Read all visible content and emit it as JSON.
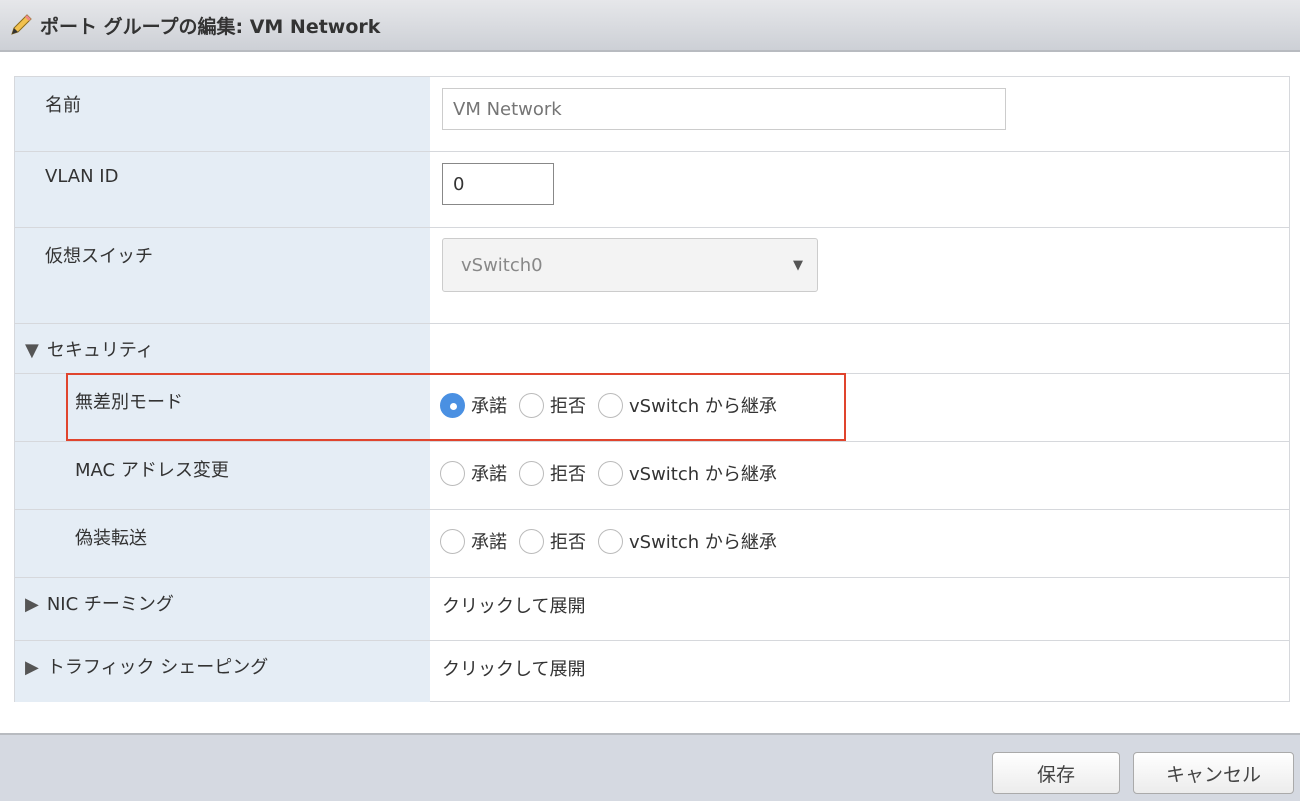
{
  "header": {
    "title": "ポート グループの編集: VM Network",
    "icon": "pencil-icon"
  },
  "fields": {
    "name": {
      "label": "名前",
      "placeholder": "VM Network"
    },
    "vlan": {
      "label": "VLAN ID",
      "value": "0"
    },
    "vswitch": {
      "label": "仮想スイッチ",
      "value": "vSwitch0"
    }
  },
  "security": {
    "label": "セキュリティ",
    "options": [
      "承諾",
      "拒否",
      "vSwitch から継承"
    ],
    "rows": [
      {
        "label": "無差別モード",
        "selected": 0
      },
      {
        "label": "MAC アドレス変更",
        "selected": null
      },
      {
        "label": "偽装転送",
        "selected": null
      }
    ]
  },
  "nic": {
    "label": "NIC チーミング",
    "value": "クリックして展開"
  },
  "traffic": {
    "label": "トラフィック シェーピング",
    "value": "クリックして展開"
  },
  "footer": {
    "save": "保存",
    "cancel": "キャンセル"
  }
}
